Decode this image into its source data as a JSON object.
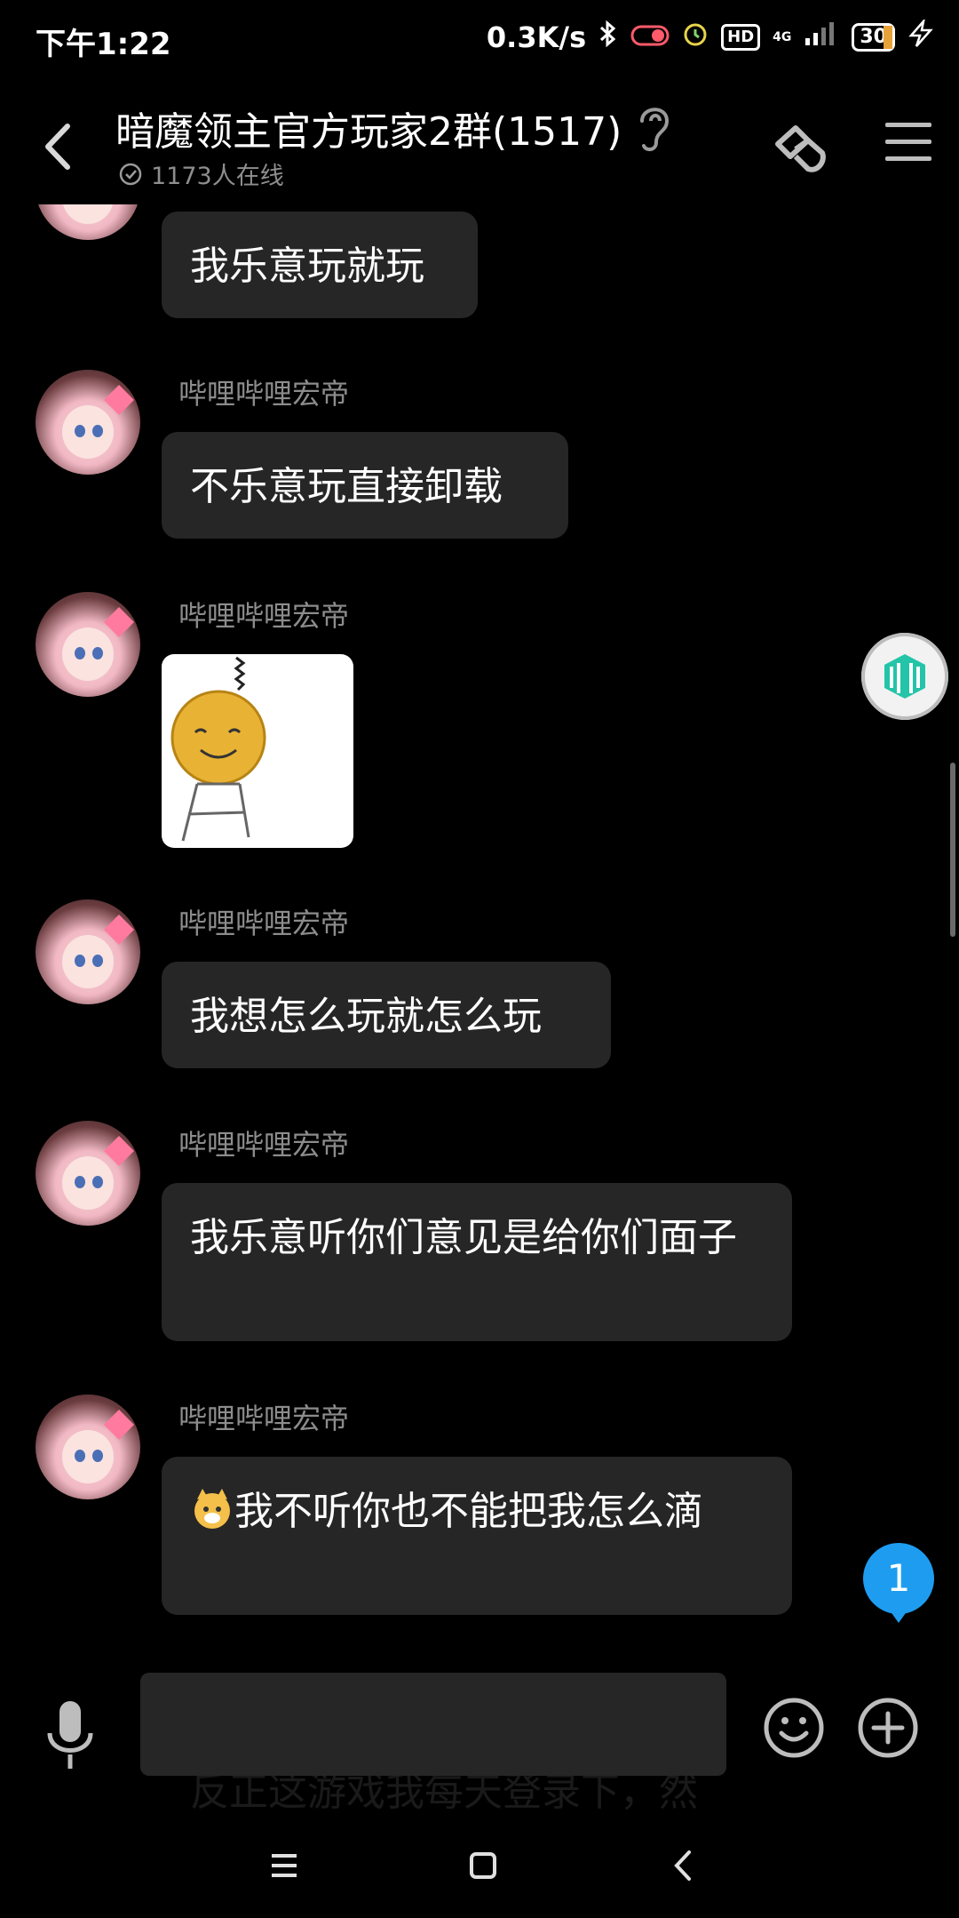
{
  "status_bar": {
    "time": "下午1:22",
    "net_speed": "0.3K/s",
    "hd": "HD",
    "network": "4G",
    "battery": "30"
  },
  "header": {
    "title": "暗魔领主官方玩家2群(1517)",
    "online": "1173人在线"
  },
  "messages": [
    {
      "sender": "",
      "text": "我乐意玩就玩"
    },
    {
      "sender": "哔哩哔哩宏帝",
      "text": "不乐意玩直接卸载"
    },
    {
      "sender": "哔哩哔哩宏帝",
      "text": ""
    },
    {
      "sender": "哔哩哔哩宏帝",
      "text": "我想怎么玩就怎么玩"
    },
    {
      "sender": "哔哩哔哩宏帝",
      "text": "我乐意听你们意见是给你们面子"
    },
    {
      "sender": "哔哩哔哩宏帝",
      "text": "我不听你也不能把我怎么滴"
    }
  ],
  "partial_message": "反正这游戏我每天登录下，然",
  "unread_count": "1",
  "input": {
    "value": "",
    "placeholder": ""
  },
  "colors": {
    "bubble": "#262626",
    "badge": "#1e9df0",
    "background": "#000000"
  }
}
